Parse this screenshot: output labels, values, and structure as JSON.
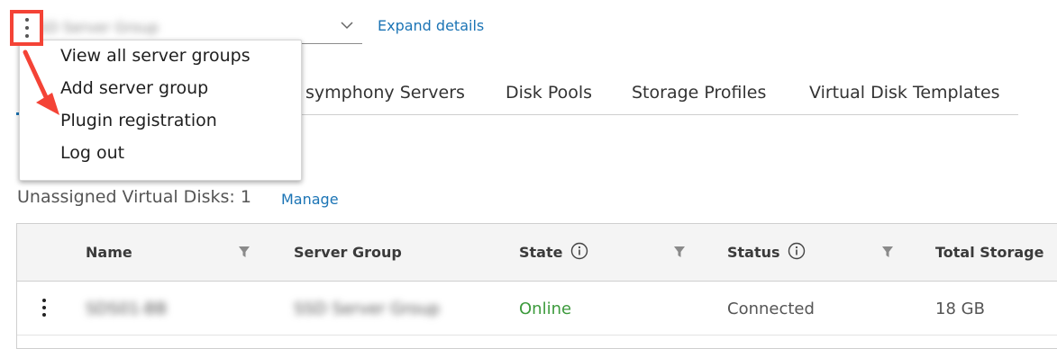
{
  "header": {
    "server_group_value": "SSD Server Group",
    "expand_details_label": "Expand details"
  },
  "tabs": [
    {
      "label": "symphony Servers"
    },
    {
      "label": "Disk Pools"
    },
    {
      "label": "Storage Profiles"
    },
    {
      "label": "Virtual Disk Templates"
    }
  ],
  "summary": {
    "unassigned_label": "Unassigned Virtual Disks: 1",
    "manage_label": "Manage"
  },
  "menu": {
    "items": [
      {
        "label": "View all server groups"
      },
      {
        "label": "Add server group"
      },
      {
        "label": "Plugin registration"
      },
      {
        "label": "Log out"
      }
    ]
  },
  "grid": {
    "columns": [
      "Name",
      "Server Group",
      "State",
      "Status",
      "Total Storage"
    ],
    "rows": [
      {
        "name": "SDS01-BB",
        "server_group": "SSD Server Group",
        "state": "Online",
        "status": "Connected",
        "total_storage": "18 GB"
      }
    ]
  },
  "colors": {
    "accent": "#1b74b5",
    "online": "#3c9a3c",
    "highlight": "#f44336"
  },
  "icons": [
    "more-vertical-icon",
    "chevron-down-icon",
    "filter-icon",
    "info-icon",
    "annotation-arrow"
  ]
}
